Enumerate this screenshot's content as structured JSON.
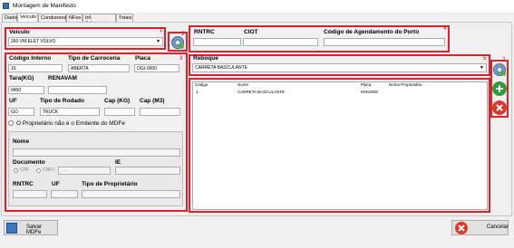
{
  "window": {
    "title": "Montagem de Manifesto"
  },
  "tabs": [
    {
      "label": "Dados"
    },
    {
      "label": "Veículo"
    },
    {
      "label": "Condutores"
    },
    {
      "label": "NFes"
    },
    {
      "label": "Inf. Adicionais"
    },
    {
      "label": "Totais"
    }
  ],
  "veiculo": {
    "label": "Veículo",
    "value": "260 VM ELET VOLVO",
    "num1": "1",
    "num2": "2"
  },
  "dados_veiculo": {
    "num": "3",
    "codigo_interno_label": "Código Interno",
    "codigo_interno": "16",
    "tipo_carroceria_label": "Tipo de Carroceria",
    "tipo_carroceria": "ABERTA",
    "placa_label": "Placa",
    "placa": "OGI-0000",
    "tara_label": "Tara(KG)",
    "tara": "9450",
    "renavam_label": "RENAVAM",
    "renavam": "",
    "uf_label": "UF",
    "uf": "GO",
    "tipo_rodado_label": "Tipo de Rodado",
    "tipo_rodado": "TRUCK",
    "cap_kg_label": "Cap (KG)",
    "cap_kg": "",
    "cap_m3_label": "Cap (M3)",
    "cap_m3": "",
    "proprietario_check": "O Proprietário não é o Emitente do MDFe",
    "nome_label": "Nome",
    "documento_label": "Documento",
    "cpf": "CPF",
    "cnpj": "CNPJ",
    "documento_value": "  .    .   -",
    "ie_label": "IE",
    "rntrc_label": "RNTRC",
    "uf2_label": "UF",
    "tipo_proprietario_label": "Tipo de Proprietário"
  },
  "ciot": {
    "num": "4",
    "rntrc_label": "RNTRC",
    "ciot_label": "CIOT",
    "codigo_agendamento_label": "Código de Agendamento do Porto"
  },
  "reboque": {
    "num": "5",
    "num7": "7",
    "label": "Reboque",
    "value": "CARRETA BASCULANTE"
  },
  "grid": {
    "num": "6",
    "headers": [
      "Código",
      "Nome",
      "Placa",
      "Nome Proprietário"
    ],
    "rows": [
      [
        "1",
        "CARRETA BASCULANTE",
        "KKK0000",
        ""
      ]
    ]
  },
  "footer": {
    "save_label": "Salvar MDFe",
    "cancel_label": "Cancelar"
  },
  "colors": {
    "highlight": "#e0202a",
    "add": "#2e9e3c",
    "remove": "#d83a2a"
  }
}
